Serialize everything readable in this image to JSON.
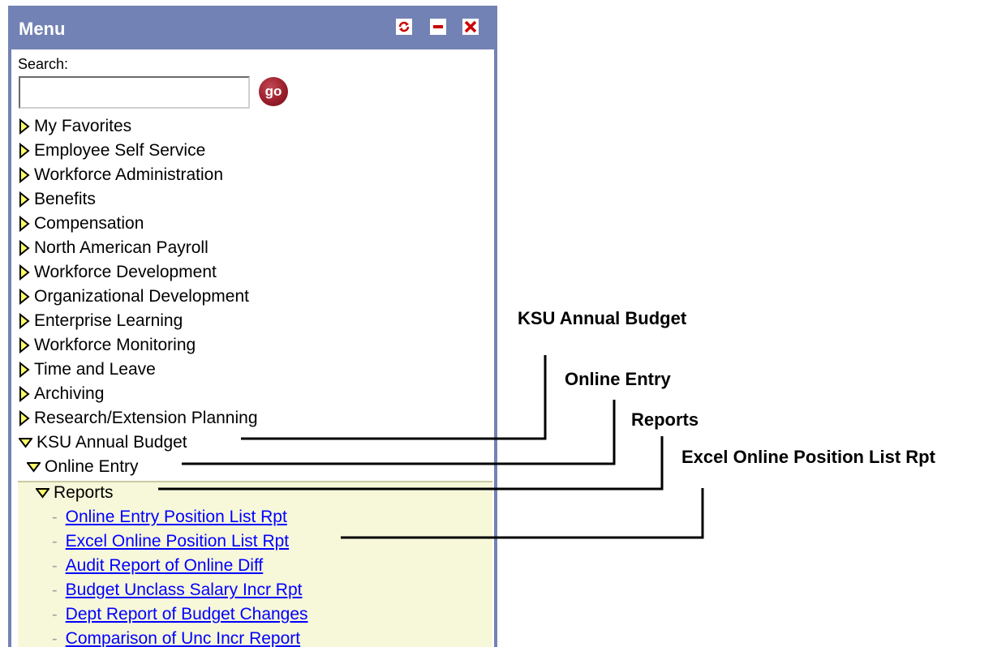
{
  "menu": {
    "title": "Menu",
    "header_icons": [
      "refresh-icon",
      "minimize-icon",
      "close-icon"
    ],
    "search_label": "Search:",
    "search_value": "",
    "go_label": "go",
    "items": [
      {
        "label": "My Favorites",
        "state": "collapsed"
      },
      {
        "label": "Employee Self Service",
        "state": "collapsed"
      },
      {
        "label": "Workforce Administration",
        "state": "collapsed"
      },
      {
        "label": "Benefits",
        "state": "collapsed"
      },
      {
        "label": "Compensation",
        "state": "collapsed"
      },
      {
        "label": "North American Payroll",
        "state": "collapsed"
      },
      {
        "label": "Workforce Development",
        "state": "collapsed"
      },
      {
        "label": "Organizational Development",
        "state": "collapsed"
      },
      {
        "label": "Enterprise Learning",
        "state": "collapsed"
      },
      {
        "label": "Workforce Monitoring",
        "state": "collapsed"
      },
      {
        "label": "Time and Leave",
        "state": "collapsed"
      },
      {
        "label": "Archiving",
        "state": "collapsed"
      },
      {
        "label": "Research/Extension Planning",
        "state": "collapsed"
      },
      {
        "label": "KSU Annual Budget",
        "state": "expanded"
      }
    ],
    "online_entry": "Online Entry",
    "reports": "Reports",
    "report_links": [
      "Online Entry Position List Rpt",
      "Excel Online Position List Rpt",
      "Audit Report of Online Diff",
      "Budget Unclass Salary Incr Rpt",
      "Dept Report of Budget Changes",
      "Comparison of Unc Incr Report"
    ]
  },
  "callouts": {
    "ksu_annual_budget": "KSU Annual Budget",
    "online_entry": "Online Entry",
    "reports": "Reports",
    "excel_report": "Excel Online Position List Rpt"
  },
  "colors": {
    "header": "#7382b4",
    "reports_bg": "#f7f7da",
    "link": "#0000ff",
    "go_button": "#9b1f2c",
    "close_red": "#cc0000"
  }
}
